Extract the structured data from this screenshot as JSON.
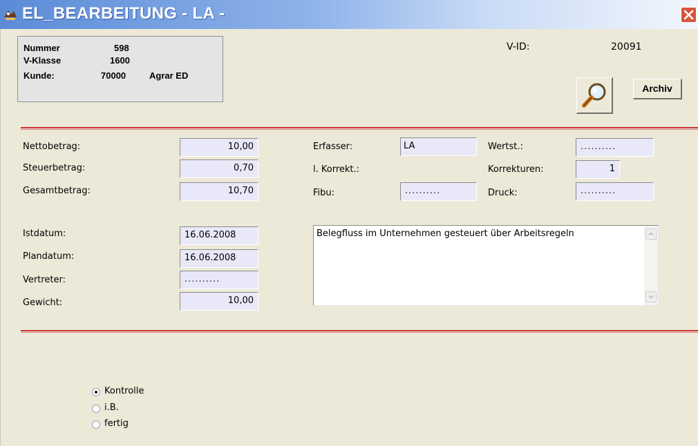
{
  "window": {
    "title": "EL_BEARBEITUNG - LA -"
  },
  "info": {
    "nummer_label": "Nummer",
    "nummer_value": "598",
    "vklasse_label": "V-Klasse",
    "vklasse_value": "1600",
    "kunde_label": "Kunde:",
    "kunde_value": "70000",
    "kunde_name": "Agrar ED"
  },
  "vid": {
    "label": "V-ID:",
    "value": "20091"
  },
  "buttons": {
    "archiv": "Archiv"
  },
  "amounts": {
    "netto_label": "Nettobetrag:",
    "netto_value": "10,00",
    "steuer_label": "Steuerbetrag:",
    "steuer_value": "0,70",
    "gesamt_label": "Gesamtbetrag:",
    "gesamt_value": "10,70"
  },
  "meta": {
    "erfasser_label": "Erfasser:",
    "erfasser_value": "LA",
    "korrekt_label": "l. Korrekt.:",
    "fibu_label": "Fibu:",
    "fibu_value": "..........",
    "wertst_label": "Wertst.:",
    "wertst_value": "..........",
    "korrekturen_label": "Korrekturen:",
    "korrekturen_value": "1",
    "druck_label": "Druck:",
    "druck_value": ".........."
  },
  "dates": {
    "ist_label": "Istdatum:",
    "ist_value": "16.06.2008",
    "plan_label": "Plandatum:",
    "plan_value": "16.06.2008",
    "vertreter_label": "Vertreter:",
    "vertreter_value": "..........",
    "gewicht_label": "Gewicht:",
    "gewicht_value": "10,00"
  },
  "memo": {
    "text": "Belegfluss im Unternehmen gesteuert über Arbeitsregeln"
  },
  "status": {
    "options": [
      "Kontrolle",
      "i.B.",
      "fertig"
    ],
    "selected": "Kontrolle"
  },
  "colors": {
    "accent_red": "#c83232",
    "field_bg": "#e8e8f8",
    "window_bg": "#ece9d8"
  },
  "icons": {
    "search": "magnifier-icon",
    "close": "close-icon",
    "app": "app-icon"
  }
}
